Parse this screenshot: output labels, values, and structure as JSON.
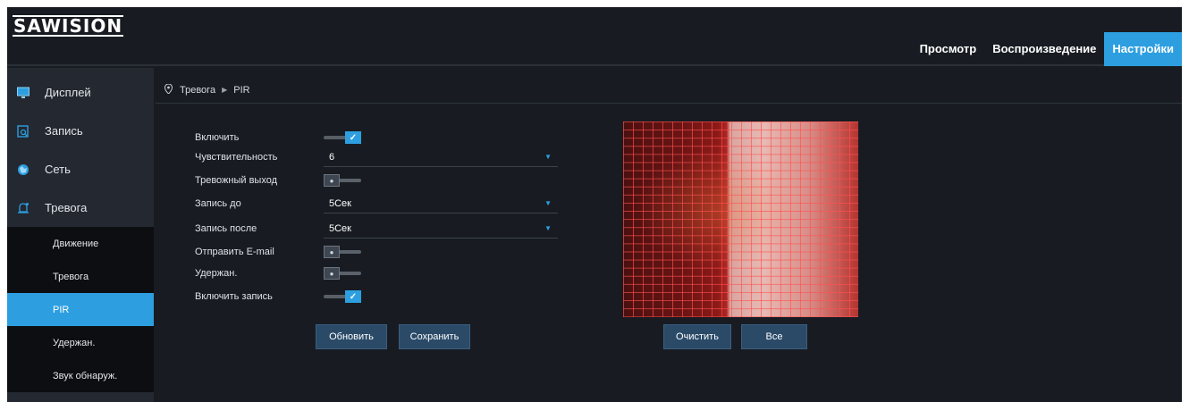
{
  "logo": "SAWISION",
  "nav": {
    "items": [
      "Просмотр",
      "Воспроизведение",
      "Настройки"
    ],
    "active": "Настройки"
  },
  "sidebar": {
    "items": [
      {
        "label": "Дисплей",
        "icon": "monitor-icon"
      },
      {
        "label": "Запись",
        "icon": "record-icon"
      },
      {
        "label": "Сеть",
        "icon": "network-icon"
      },
      {
        "label": "Тревога",
        "icon": "alarm-bell-icon"
      }
    ],
    "subitems": [
      "Движение",
      "Тревога",
      "PIR",
      "Удержан.",
      "Звук обнаруж."
    ],
    "active_sub": "PIR"
  },
  "breadcrumb": {
    "icon": "location-pin-icon",
    "items": [
      "Тревога",
      "PIR"
    ]
  },
  "form": {
    "enable_label": "Включить",
    "enable_on": true,
    "sensitivity_label": "Чувствительность",
    "sensitivity_value": "6",
    "alarm_out_label": "Тревожный выход",
    "alarm_out_on": false,
    "pre_record_label": "Запись до",
    "pre_record_value": "5Сек",
    "post_record_label": "Запись после",
    "post_record_value": "5Сек",
    "email_label": "Отправить E-mail",
    "email_on": false,
    "hold_label": "Удержан.",
    "hold_on": false,
    "enable_record_label": "Включить запись",
    "enable_record_on": true
  },
  "buttons": {
    "refresh": "Обновить",
    "save": "Сохранить",
    "clear": "Очистить",
    "all": "Все"
  },
  "colors": {
    "accent": "#2d9fe0",
    "background": "#181c22",
    "sidebar": "#232831"
  }
}
